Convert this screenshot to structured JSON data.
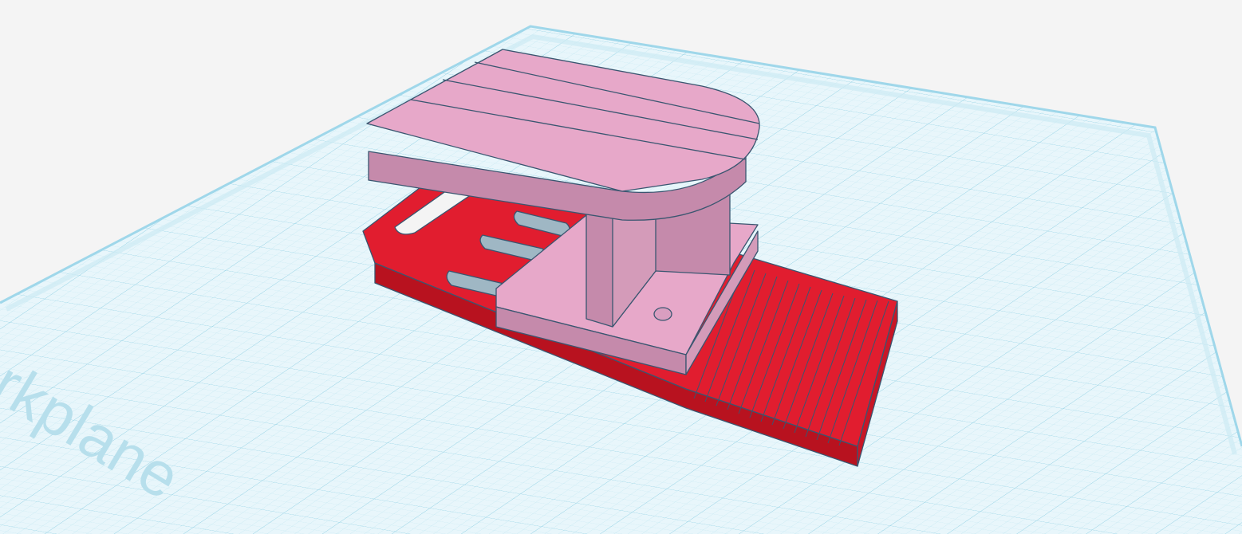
{
  "workplane": {
    "label": "Workplane",
    "grid_color": "#a9dceb",
    "plane_color": "#e6f5fa",
    "edge_color": "#bfe6f2"
  },
  "model": {
    "base_color": "#e11d2f",
    "base_dark": "#b8121f",
    "top_color": "#e7a8c9",
    "top_dark": "#c58aab",
    "outline": "#3a5670"
  }
}
